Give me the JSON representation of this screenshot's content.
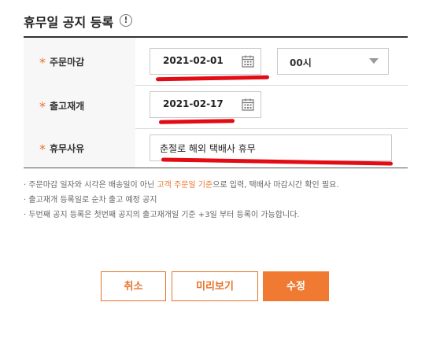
{
  "header": {
    "title": "휴무일 공지 등록",
    "info_icon": "!"
  },
  "form": {
    "order_deadline": {
      "required_mark": "*",
      "label": "주문마감",
      "date": "2021-02-01",
      "time_value": "00시"
    },
    "shipping_resume": {
      "required_mark": "*",
      "label": "출고재개",
      "date": "2021-02-17"
    },
    "reason": {
      "required_mark": "*",
      "label": "휴무사유",
      "value": "춘절로 해외 택배사 휴무"
    }
  },
  "notes": {
    "line1_prefix": "주문마감 일자와 시각은 배송일이 아닌 ",
    "line1_highlight": "고객 주문일 기준",
    "line1_suffix": "으로 입력, 택배사 마감시간 확인 필요.",
    "line2": "출고재개 등록일로 순차 출고 예정 공지",
    "line3": "두번째 공지 등록은 첫번째 공지의 출고재개일 기준 +3일 부터 등록이 가능합니다."
  },
  "buttons": {
    "cancel": "취소",
    "preview": "미리보기",
    "edit": "수정"
  },
  "colors": {
    "accent": "#e8722a",
    "red_mark": "#e30b14"
  }
}
